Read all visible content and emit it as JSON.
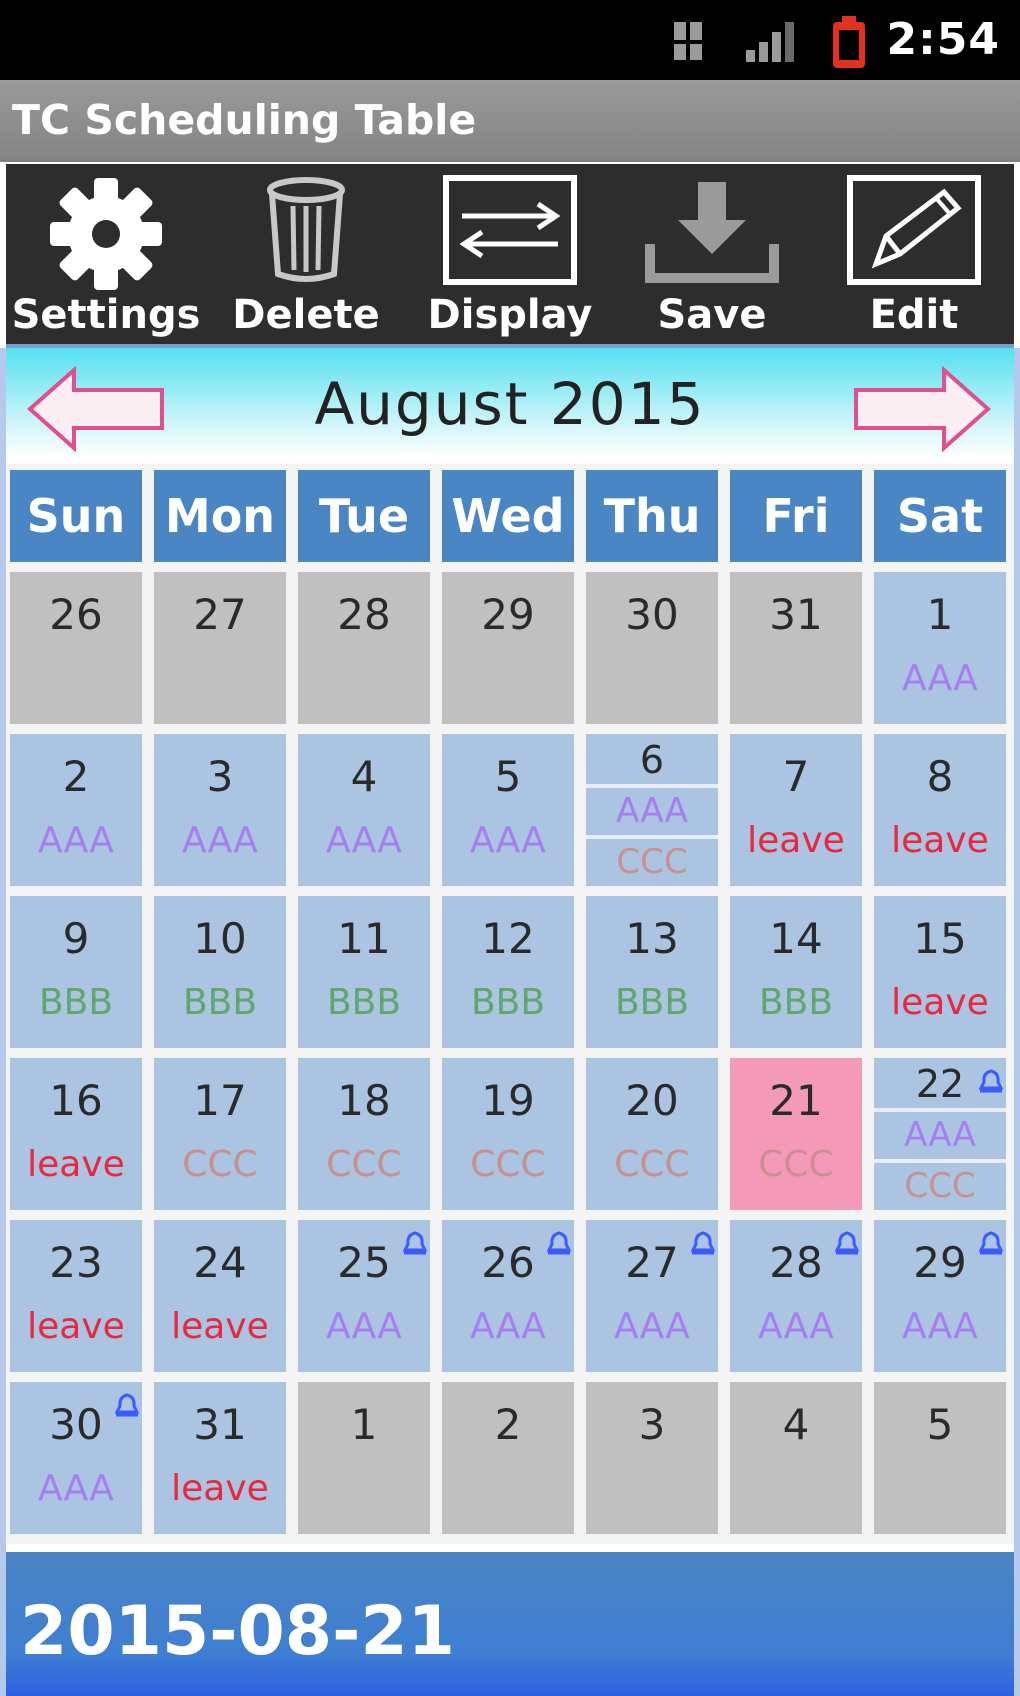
{
  "status_bar": {
    "time": "2:54"
  },
  "app": {
    "title": "TC Scheduling Table"
  },
  "toolbar": {
    "settings_label": "Settings",
    "delete_label": "Delete",
    "display_label": "Display",
    "save_label": "Save",
    "edit_label": "Edit"
  },
  "calendar": {
    "month_title": "August  2015",
    "weekdays": [
      "Sun",
      "Mon",
      "Tue",
      "Wed",
      "Thu",
      "Fri",
      "Sat"
    ],
    "rows": [
      [
        {
          "day": "26",
          "other": true
        },
        {
          "day": "27",
          "other": true
        },
        {
          "day": "28",
          "other": true
        },
        {
          "day": "29",
          "other": true
        },
        {
          "day": "30",
          "other": true
        },
        {
          "day": "31",
          "other": true
        },
        {
          "day": "1",
          "events": [
            "AAA"
          ]
        }
      ],
      [
        {
          "day": "2",
          "events": [
            "AAA"
          ]
        },
        {
          "day": "3",
          "events": [
            "AAA"
          ]
        },
        {
          "day": "4",
          "events": [
            "AAA"
          ]
        },
        {
          "day": "5",
          "events": [
            "AAA"
          ]
        },
        {
          "day": "6",
          "events": [
            "AAA",
            "CCC"
          ]
        },
        {
          "day": "7",
          "events": [
            "leave"
          ]
        },
        {
          "day": "8",
          "events": [
            "leave"
          ]
        }
      ],
      [
        {
          "day": "9",
          "events": [
            "BBB"
          ]
        },
        {
          "day": "10",
          "events": [
            "BBB"
          ]
        },
        {
          "day": "11",
          "events": [
            "BBB"
          ]
        },
        {
          "day": "12",
          "events": [
            "BBB"
          ]
        },
        {
          "day": "13",
          "events": [
            "BBB"
          ]
        },
        {
          "day": "14",
          "events": [
            "BBB"
          ]
        },
        {
          "day": "15",
          "events": [
            "leave"
          ]
        }
      ],
      [
        {
          "day": "16",
          "events": [
            "leave"
          ]
        },
        {
          "day": "17",
          "events": [
            "CCC"
          ]
        },
        {
          "day": "18",
          "events": [
            "CCC"
          ]
        },
        {
          "day": "19",
          "events": [
            "CCC"
          ]
        },
        {
          "day": "20",
          "events": [
            "CCC"
          ]
        },
        {
          "day": "21",
          "events": [
            "CCC"
          ],
          "selected": true
        },
        {
          "day": "22",
          "events": [
            "AAA",
            "CCC"
          ],
          "alarm": true
        }
      ],
      [
        {
          "day": "23",
          "events": [
            "leave"
          ]
        },
        {
          "day": "24",
          "events": [
            "leave"
          ]
        },
        {
          "day": "25",
          "events": [
            "AAA"
          ],
          "alarm": true
        },
        {
          "day": "26",
          "events": [
            "AAA"
          ],
          "alarm": true
        },
        {
          "day": "27",
          "events": [
            "AAA"
          ],
          "alarm": true
        },
        {
          "day": "28",
          "events": [
            "AAA"
          ],
          "alarm": true
        },
        {
          "day": "29",
          "events": [
            "AAA"
          ],
          "alarm": true
        }
      ],
      [
        {
          "day": "30",
          "events": [
            "AAA"
          ],
          "alarm": true
        },
        {
          "day": "31",
          "events": [
            "leave"
          ]
        },
        {
          "day": "1",
          "other": true
        },
        {
          "day": "2",
          "other": true
        },
        {
          "day": "3",
          "other": true
        },
        {
          "day": "4",
          "other": true
        },
        {
          "day": "5",
          "other": true
        }
      ]
    ]
  },
  "footer": {
    "selected_date": "2015-08-21"
  },
  "colors": {
    "aaa": "#a77ef0",
    "bbb": "#5fa86c",
    "ccc": "#c99090",
    "leave": "#e8283c",
    "cell": "#abc4e2",
    "other_month": "#c0c0c0",
    "selected": "#f49ab8",
    "header": "#4a85c4"
  },
  "icons": {
    "settings": "gear-icon",
    "delete": "trash-icon",
    "display": "swap-arrows-icon",
    "save": "download-icon",
    "edit": "pencil-icon",
    "prev": "arrow-left-icon",
    "next": "arrow-right-icon",
    "alarm": "bell-icon"
  }
}
